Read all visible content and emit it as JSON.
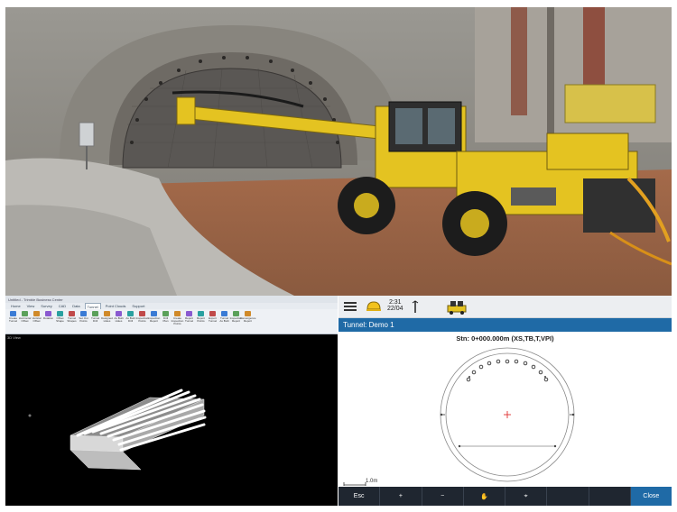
{
  "photo": {
    "icon": "tunnel-drill-rig-photo"
  },
  "software": {
    "title": "Untitled - Trimble Business Center",
    "tabs": [
      "Home",
      "View",
      "Survey",
      "CAD",
      "Data",
      "Tunnel",
      "Point Clouds",
      "Support"
    ],
    "active_tab": "Tunnel",
    "tools": [
      "Create Tunnel",
      "Horizontal Offset",
      "Vertical Offset",
      "Rotation",
      "Offset Shape",
      "Tunnel Shapes",
      "Set Out Points",
      "Tunnel Drill",
      "Designed Holes",
      "As Built Holes",
      "As Built Drill",
      "Inspection Points",
      "Inspection Report",
      "Drill Plan",
      "Create Inspection Points",
      "Report Tunnel",
      "Report Points",
      "Export Tunnel",
      "Tunnel As Built",
      "Inspection Report",
      "Convergence Report"
    ],
    "viewport_label": "3D View"
  },
  "tablet": {
    "time": "2:31",
    "date": "22/04",
    "title": "Tunnel: Demo 1",
    "station": "Stn: 0+000.000m (XS,TB,T,VPI)",
    "scale_label": "1.0m",
    "buttons": {
      "esc": "Esc",
      "zoom_in": "+",
      "zoom_out": "−",
      "pan": "✋",
      "center": "⌖",
      "close": "Close"
    }
  }
}
